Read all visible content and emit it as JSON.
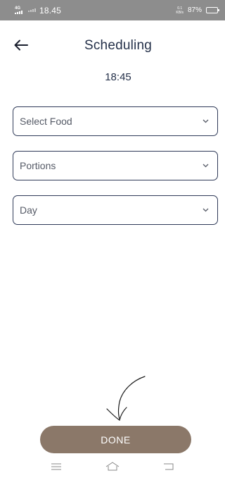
{
  "status_bar": {
    "network_label": "4G",
    "time": "18.45",
    "net_speed_value": "0.1",
    "net_speed_unit": "KB/s",
    "battery": "87%"
  },
  "header": {
    "back_icon": "arrow-left-icon",
    "title": "Scheduling",
    "time": "18:45"
  },
  "form": {
    "fields": [
      {
        "label": "Select Food",
        "icon": "chevron-down-icon"
      },
      {
        "label": "Portions",
        "icon": "chevron-down-icon"
      },
      {
        "label": "Day",
        "icon": "chevron-down-icon"
      }
    ]
  },
  "actions": {
    "done_label": "DONE",
    "done_color": "#8b7869"
  },
  "nav_bar": {
    "items": [
      "menu-icon",
      "home-icon",
      "back-icon"
    ]
  },
  "colors": {
    "status_bar": "#8d8d8d",
    "title_text": "#243049",
    "field_border": "#2f3a58"
  }
}
